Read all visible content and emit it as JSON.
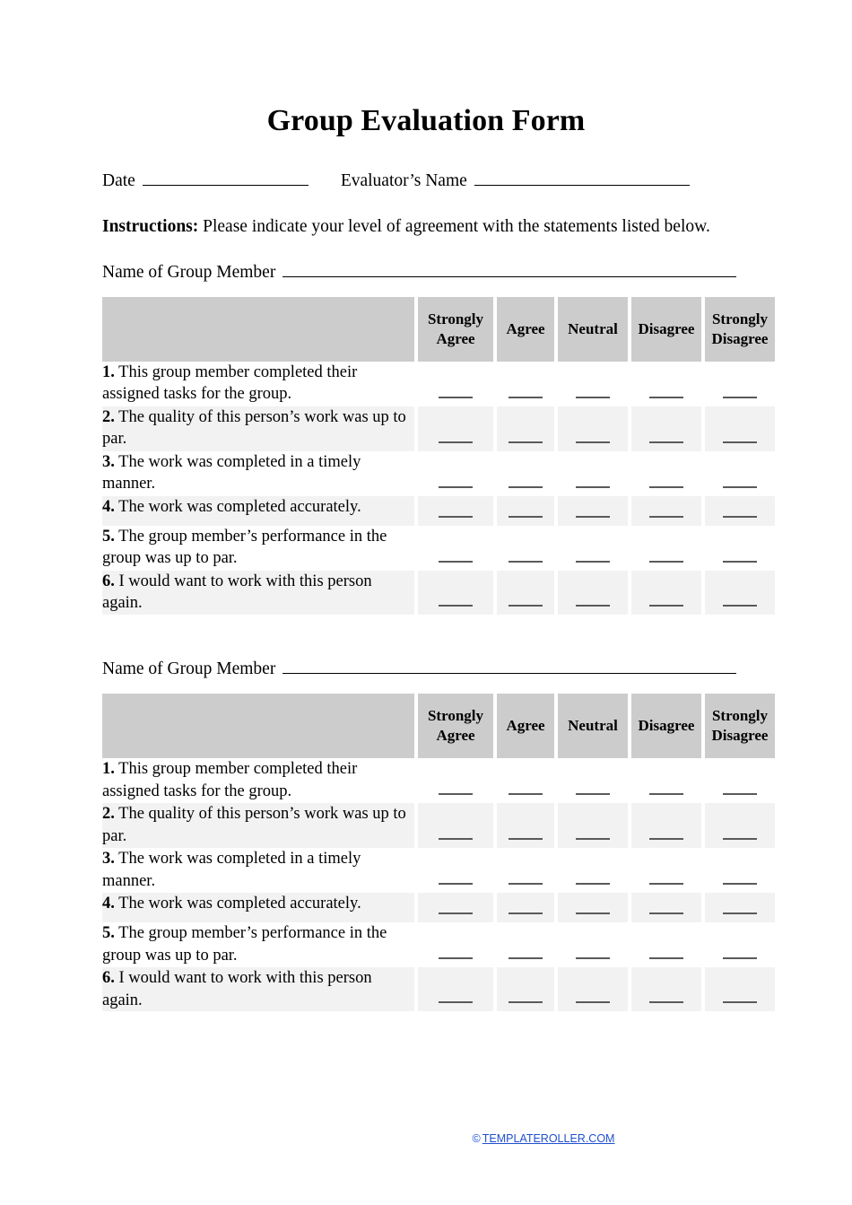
{
  "document": {
    "title": "Group Evaluation Form",
    "fields": {
      "date_label": "Date",
      "evaluator_label": "Evaluator’s Name",
      "member_label": "Name of Group Member"
    },
    "instructions": {
      "bold_prefix": "Instructions:",
      "text": " Please indicate your level of agreement with the statements listed below."
    }
  },
  "table": {
    "columns": [
      {
        "key": "statement",
        "label": ""
      },
      {
        "key": "strongly_agree",
        "label": "Strongly Agree"
      },
      {
        "key": "agree",
        "label": "Agree"
      },
      {
        "key": "neutral",
        "label": "Neutral"
      },
      {
        "key": "disagree",
        "label": "Disagree"
      },
      {
        "key": "strongly_disagree",
        "label": "Strongly Disagree"
      }
    ],
    "rows": [
      {
        "number": "1.",
        "statement": "This group member completed their assigned tasks for the group."
      },
      {
        "number": "2.",
        "statement": "The quality of this person’s work was up to par."
      },
      {
        "number": "3.",
        "statement": "The work was completed in a timely manner."
      },
      {
        "number": "4.",
        "statement": "The work was completed accurately."
      },
      {
        "number": "5.",
        "statement": "The group member’s performance in the group was up to par."
      },
      {
        "number": "6.",
        "statement": "I would want to work with this person again."
      }
    ]
  },
  "sections": [
    {
      "member_label": "Name of Group Member"
    },
    {
      "member_label": "Name of Group Member"
    }
  ],
  "footer": {
    "copyright_symbol": "©",
    "site": "TEMPLATEROLLER.COM"
  },
  "colors": {
    "header_fill": "#cccccc",
    "row_alt_fill": "#f2f2f2",
    "row_fill": "#ffffff",
    "blank_line": "#5a5a5a",
    "link": "#2050d0",
    "text": "#000000"
  }
}
